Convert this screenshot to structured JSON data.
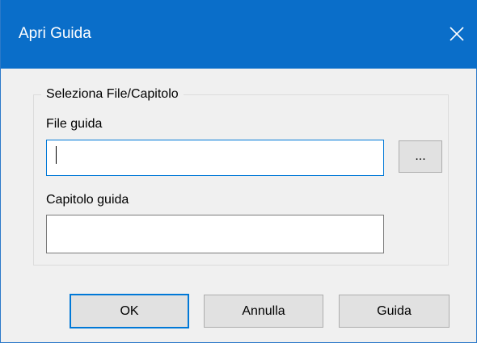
{
  "window": {
    "title": "Apri Guida",
    "close_icon": "close-icon"
  },
  "group": {
    "legend": "Seleziona File/Capitolo",
    "file_label": "File guida",
    "file_value": "",
    "browse_label": "...",
    "chapter_label": "Capitolo guida",
    "chapter_value": ""
  },
  "buttons": {
    "ok": "OK",
    "cancel": "Annulla",
    "help": "Guida"
  },
  "colors": {
    "titlebar": "#0a6ec9",
    "focus": "#0078d7"
  }
}
